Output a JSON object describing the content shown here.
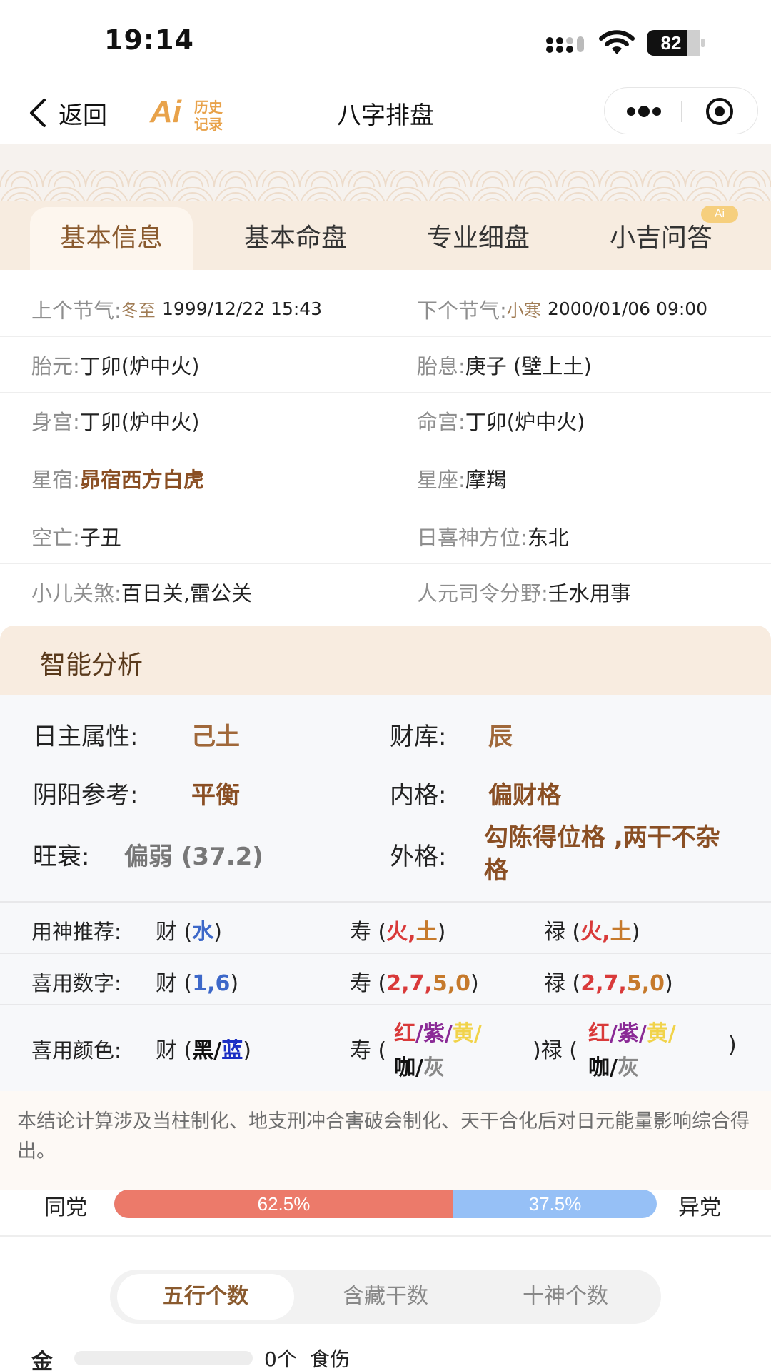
{
  "status": {
    "time": "19:14",
    "battery": "82"
  },
  "nav": {
    "back_label": "返回",
    "logo_ai": "Ai",
    "logo_line1": "历史",
    "logo_line2": "记录",
    "title": "八字排盘"
  },
  "tabs": [
    {
      "label": "基本信息",
      "active": true
    },
    {
      "label": "基本命盘"
    },
    {
      "label": "专业细盘"
    },
    {
      "label": "小吉问答"
    }
  ],
  "ai_badge": "Ai",
  "info": {
    "prev_term_key": "上个节气:",
    "prev_term_name": "冬至",
    "prev_term_time": "1999/12/22 15:43",
    "next_term_key": "下个节气:",
    "next_term_name": "小寒",
    "next_term_time": "2000/01/06 09:00",
    "taiyuan_key": "胎元:",
    "taiyuan_val": "丁卯(炉中火)",
    "taixi_key": "胎息:",
    "taixi_val": "庚子 (壁上土)",
    "shengong_key": "身宫:",
    "shengong_val": "丁卯(炉中火)",
    "minggong_key": "命宫:",
    "minggong_val": "丁卯(炉中火)",
    "xingxiu_key": "星宿:",
    "xingxiu_val": "昴宿西方白虎",
    "xingzuo_key": "星座:",
    "xingzuo_val": "摩羯",
    "kongwang_key": "空亡:",
    "kongwang_val": "子丑",
    "xishen_key": "日喜神方位:",
    "xishen_val": "东北",
    "xiaoer_key": "小儿关煞:",
    "xiaoer_val": "百日关,雷公关",
    "renyuan_key": "人元司令分野:",
    "renyuan_val": "壬水用事"
  },
  "analysis": {
    "title": "智能分析",
    "rizhu_label": "日主属性:",
    "rizhu_val": "己土",
    "caiku_label": "财库:",
    "caiku_val": "辰",
    "yinyang_label": "阴阳参考:",
    "yinyang_val": "平衡",
    "neige_label": "内格:",
    "neige_val": "偏财格",
    "wangshuai_label": "旺衰:",
    "wangshuai_val": "偏弱 (37.2)",
    "waige_label": "外格:",
    "waige_val": "勾陈得位格 ,两干不杂格",
    "yongshen": {
      "label": "用神推荐:",
      "cai": "财 (",
      "cai_v1": "水",
      "close": ")",
      "shou": "寿 (",
      "shou_v1": "火",
      "comma": ",",
      "shou_v2": "土",
      "lu": "禄 (",
      "lu_v1": "火",
      "lu_v2": "土"
    },
    "shuzi": {
      "label": "喜用数字:",
      "cai": "财 (",
      "cai_v1": "1",
      "cai_v2": "6",
      "close": ")",
      "shou": "寿 (",
      "n2": "2",
      "n7": "7",
      "n5": "5",
      "n0": "0",
      "comma": ",",
      "lu": "禄 ("
    },
    "yanse": {
      "label": "喜用颜色:",
      "cai": "财 (",
      "hei": "黑",
      "slash": "/",
      "lan": "蓝",
      "close": ")",
      "shou": "寿 (",
      "hong": "红",
      "zi": "紫",
      "huang": "黄",
      "ka": "咖",
      "hui": "灰",
      "lu": ")禄 (",
      "end": ")"
    }
  },
  "note": "本结论计算涉及当柱制化、地支刑冲合害破会制化、天干合化后对日元能量影响综合得出。",
  "party": {
    "left_label": "同党",
    "right_label": "异党",
    "same_pct": 62.5,
    "same_text": "62.5%",
    "diff_text": "37.5%"
  },
  "seg_tabs": [
    {
      "label": "五行个数",
      "active": true
    },
    {
      "label": "含藏干数"
    },
    {
      "label": "十神个数"
    }
  ],
  "stats": [
    {
      "name": "金",
      "count": "0个",
      "tag": "食伤",
      "fraction": 0
    }
  ],
  "colors": {
    "accent": "#8a5a2e",
    "same_party": "#ec7a6a",
    "diff_party": "#96c0f6"
  }
}
